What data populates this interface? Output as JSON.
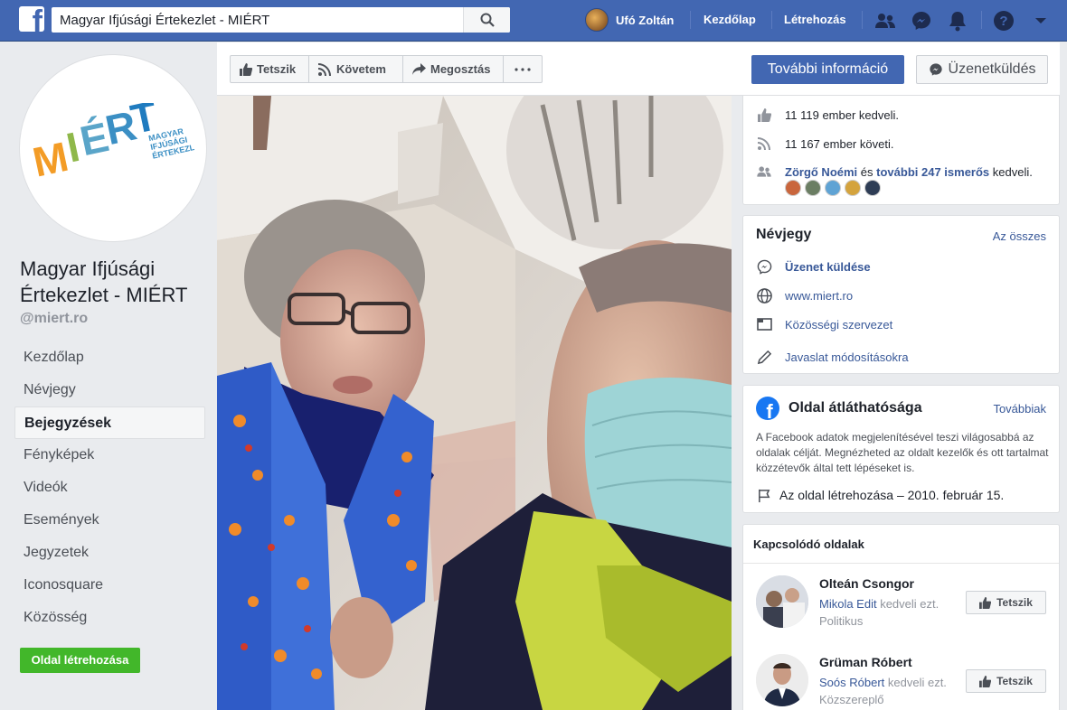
{
  "topbar": {
    "search_value": "Magyar Ifjúsági Értekezlet - MIÉRT",
    "user_name": "Ufó Zoltán",
    "nav_home": "Kezdőlap",
    "nav_create": "Létrehozás"
  },
  "sidebar": {
    "logo_word": "MIÉRT",
    "logo_tag": [
      "MAGYAR",
      "IFJÚSÁGI",
      "ÉRTEKEZLET"
    ],
    "page_name": "Magyar Ifjúsági Értekezlet - MIÉRT",
    "handle": "@miert.ro",
    "items": [
      {
        "label": "Kezdőlap"
      },
      {
        "label": "Névjegy"
      },
      {
        "label": "Bejegyzések"
      },
      {
        "label": "Fényképek"
      },
      {
        "label": "Videók"
      },
      {
        "label": "Események"
      },
      {
        "label": "Jegyzetek"
      },
      {
        "label": "Iconosquare"
      },
      {
        "label": "Közösség"
      }
    ],
    "create_page_label": "Oldal létrehozása"
  },
  "actions": {
    "like": "Tetszik",
    "follow": "Követem",
    "share": "Megosztás",
    "more_info": "További információ",
    "message": "Üzenetküldés"
  },
  "stats": {
    "likes": "11 119 ember kedveli.",
    "follows": "11 167 ember követi.",
    "friend_name": "Zörgő Noémi",
    "friends_and": "és",
    "friends_more": "további 247 ismerős",
    "friends_suffix": "kedveli."
  },
  "about": {
    "title": "Névjegy",
    "see_all": "Az összes",
    "send_message": "Üzenet küldése",
    "website": "www.miert.ro",
    "category": "Közösségi szervezet",
    "suggest": "Javaslat módosításokra"
  },
  "transparency": {
    "title": "Oldal átláthatósága",
    "more": "Továbbiak",
    "description": "A Facebook adatok megjelenítésével teszi világosabbá az oldalak célját. Megnézheted az oldalt kezelők és ott tartalmat közzétevők által tett lépéseket is.",
    "created": "Az oldal létrehozása – 2010. február 15."
  },
  "related": {
    "title": "Kapcsolódó oldalak",
    "pages": [
      {
        "name": "Olteán Csongor",
        "friend": "Mikola Edit",
        "liked_text": "kedveli ezt.",
        "category": "Politikus",
        "button": "Tetszik"
      },
      {
        "name": "Grüman Róbert",
        "friend": "Soós Róbert",
        "liked_text": "kedveli ezt.",
        "category": "Közszereplő",
        "button": "Tetszik"
      }
    ]
  },
  "colors": {
    "brand_blue": "#4267b2",
    "link_blue": "#385898",
    "green": "#42b72a"
  }
}
